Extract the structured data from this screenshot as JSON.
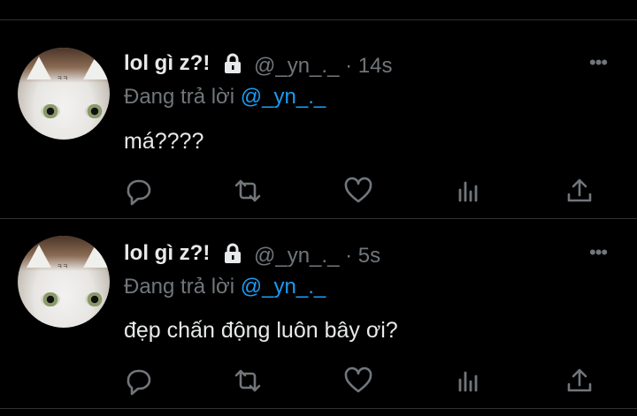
{
  "tweets": [
    {
      "display_name": "lol gì z?!",
      "handle": "@_yn_._",
      "time": "· 14s",
      "reply_prefix": "Đang trả lời",
      "reply_to": "@_yn_._",
      "text": "má????"
    },
    {
      "display_name": "lol gì z?!",
      "handle": "@_yn_._",
      "time": "· 5s",
      "reply_prefix": "Đang trả lời",
      "reply_to": "@_yn_._",
      "text": "đẹp chấn động luôn bây ơi?"
    }
  ],
  "icons": {
    "more": "more-icon",
    "reply": "reply-icon",
    "retweet": "retweet-icon",
    "like": "like-icon",
    "views": "views-icon",
    "share": "share-icon",
    "lock": "lock-icon"
  },
  "colors": {
    "background": "#000000",
    "text": "#e7e9ea",
    "muted": "#71767b",
    "mention": "#1d9bf0",
    "divider": "#2f3336"
  }
}
